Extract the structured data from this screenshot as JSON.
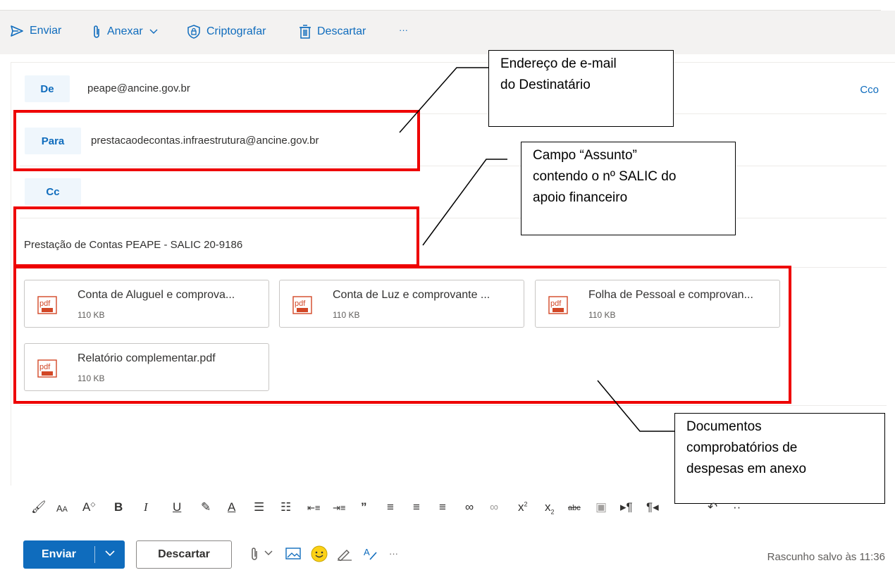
{
  "toolbar": {
    "send": "Enviar",
    "attach": "Anexar",
    "encrypt": "Criptografar",
    "discard": "Descartar",
    "more": "···"
  },
  "fields": {
    "from_label": "De",
    "from_value": "peape@ancine.gov.br",
    "bcc": "Cco",
    "to_label": "Para",
    "to_value": "prestacaodecontas.infraestrutura@ancine.gov.br",
    "cc_label": "Cc",
    "subject": "Prestação de Contas PEAPE - SALIC 20-9186"
  },
  "attachments": [
    {
      "name": "Conta de Aluguel e comprova...",
      "size": "110 KB",
      "type": "pdf"
    },
    {
      "name": "Conta de Luz e comprovante ...",
      "size": "110 KB",
      "type": "pdf"
    },
    {
      "name": "Folha de Pessoal e comprovan...",
      "size": "110 KB",
      "type": "pdf"
    },
    {
      "name": "Relatório complementar.pdf",
      "size": "110 KB",
      "type": "pdf"
    }
  ],
  "callouts": {
    "recipient": [
      "Endereço de e-mail",
      "do Destinatário"
    ],
    "subject": [
      "Campo “Assunto”",
      "contendo o nº SALIC do",
      "apoio financeiro"
    ],
    "documents": [
      "Documentos",
      "comprobatórios de",
      "despesas em anexo"
    ]
  },
  "format_toolbar": {
    "icons": [
      "format-painter-icon",
      "font-size-icon",
      "grow-font-icon",
      "bold-icon",
      "italic-icon",
      "underline-icon",
      "highlight-icon",
      "font-color-icon",
      "bullets-icon",
      "numbering-icon",
      "decrease-indent-icon",
      "increase-indent-icon",
      "quote-icon",
      "align-left-icon",
      "align-center-icon",
      "align-right-icon",
      "link-icon",
      "remove-link-icon",
      "superscript-icon",
      "subscript-icon",
      "strikethrough-icon",
      "picture-icon",
      "ltr-icon",
      "rtl-icon",
      "undo-icon",
      "more-icon"
    ]
  },
  "bottom": {
    "send": "Enviar",
    "discard": "Descartar",
    "more": "···",
    "status": "Rascunho salvo às 11:36"
  },
  "colors": {
    "accent": "#0f6cbd",
    "highlight_box": "#ee0000",
    "pdf": "#d24726"
  }
}
